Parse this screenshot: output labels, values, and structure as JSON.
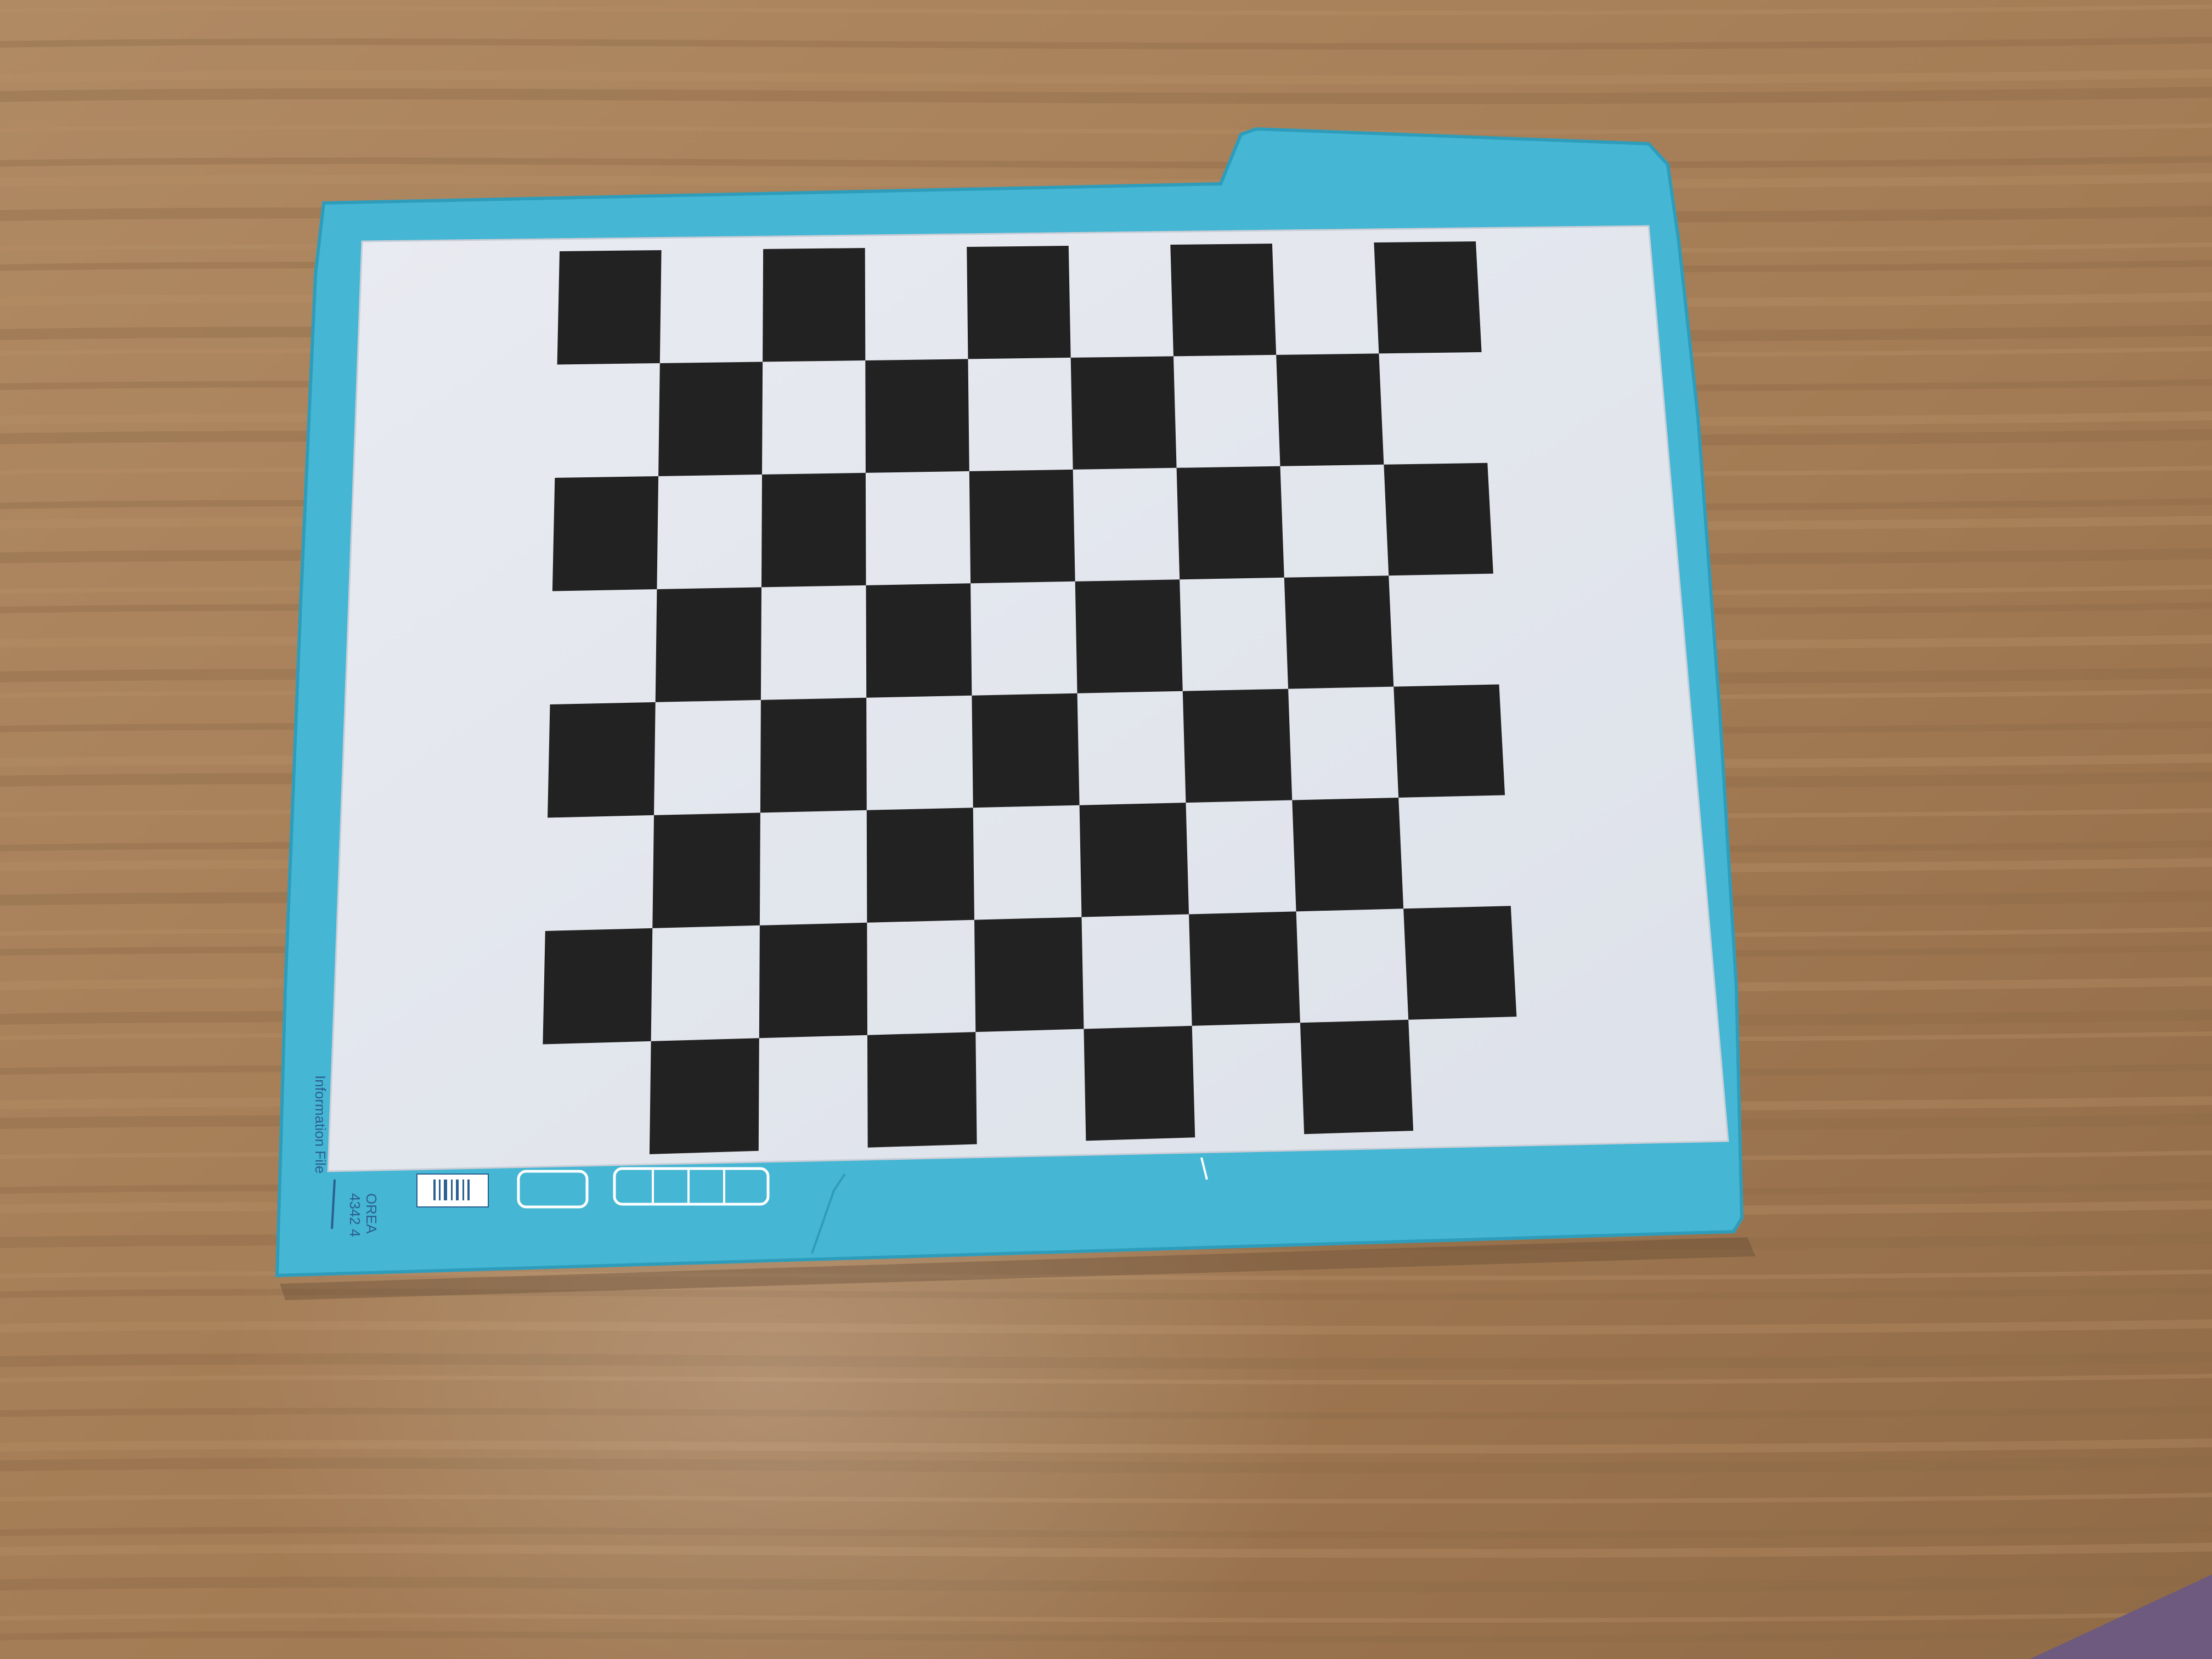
{
  "colors": {
    "desk": "#a57e57",
    "desk_grain_dark": "#8c6a47",
    "desk_grain_light": "#b89068",
    "folder": "#45b6d4",
    "folder_edge": "#2e9dbc",
    "paper": "#e4e7ee",
    "square": "#222222",
    "print_blue": "#2a5f8f"
  },
  "checkerboard": {
    "rows": 8,
    "columns": 9,
    "first_square_dark": true
  },
  "folder_print": {
    "label_vertical": "Information File",
    "code_line_1": "OREA",
    "code_line_2": "4342 4"
  }
}
